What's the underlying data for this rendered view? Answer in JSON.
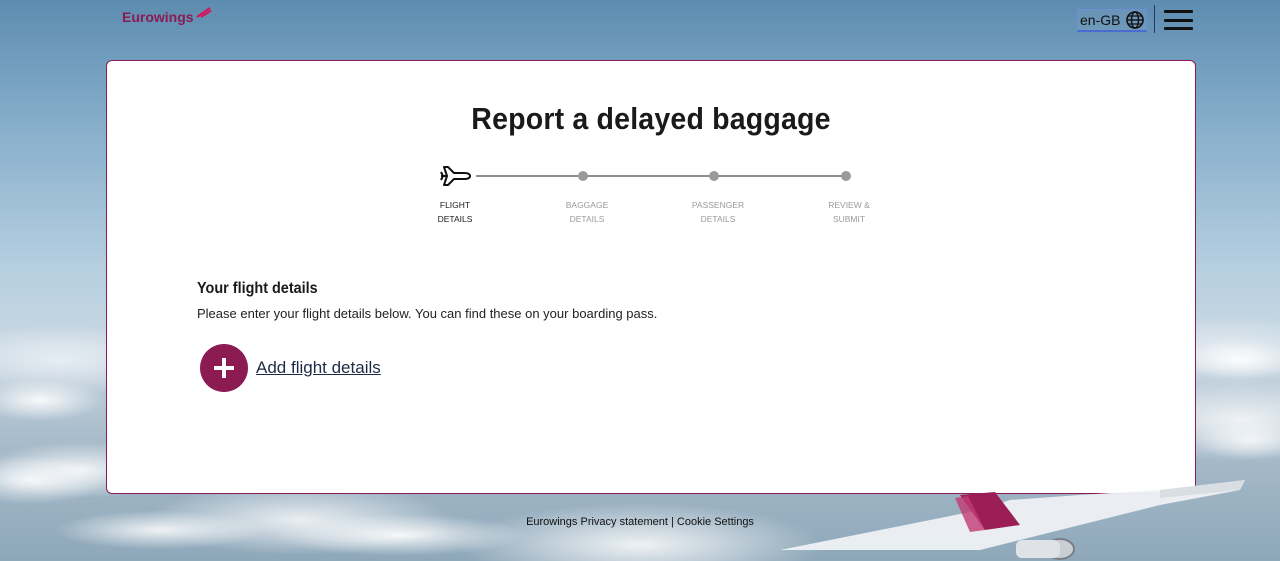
{
  "header": {
    "logo_text": "Eurowings",
    "language": "en-GB",
    "icons": {
      "language": "globe-icon",
      "menu": "hamburger-menu-icon"
    }
  },
  "card": {
    "title": "Report a delayed baggage",
    "steps": [
      {
        "line1": "FLIGHT",
        "line2": "DETAILS",
        "active": true
      },
      {
        "line1": "BAGGAGE",
        "line2": "DETAILS",
        "active": false
      },
      {
        "line1": "PASSENGER",
        "line2": "DETAILS",
        "active": false
      },
      {
        "line1": "REVIEW &",
        "line2": "SUBMIT",
        "active": false
      }
    ],
    "section": {
      "title": "Your flight details",
      "description": "Please enter your flight details below. You can find these on your boarding pass.",
      "add_label": "Add flight details"
    }
  },
  "footer": {
    "privacy_label": "Eurowings Privacy statement",
    "separator": " | ",
    "cookie_label": "Cookie Settings"
  },
  "colors": {
    "brand": "#8c1b54",
    "text": "#1a1a1a",
    "muted": "#9a9a9a"
  }
}
